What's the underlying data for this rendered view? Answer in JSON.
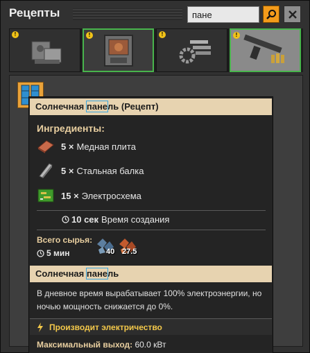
{
  "window": {
    "title": "Рецепты",
    "search": {
      "value": "пане",
      "icon": "search-icon",
      "close_icon": "close-icon"
    },
    "accent": "#f39b1b"
  },
  "tabs": [
    {
      "name": "logistics",
      "icon": "logistics-icon",
      "alert": "!"
    },
    {
      "name": "production",
      "icon": "production-icon",
      "alert": "!"
    },
    {
      "name": "intermediate-products",
      "icon": "intermediate-products-icon",
      "alert": "!"
    },
    {
      "name": "combat",
      "icon": "combat-icon",
      "alert": "!"
    }
  ],
  "recipe_slot": {
    "icon": "solar-panel-icon"
  },
  "tooltip": {
    "recipe_header": {
      "before": "Солнечная ",
      "highlight": "пане",
      "after": "ль (Рецепт)"
    },
    "ingredients_title": "Ингредиенты:",
    "ingredients": [
      {
        "amount": "5 ×",
        "name": "Медная плита",
        "icon": "copper-plate-icon"
      },
      {
        "amount": "5 ×",
        "name": "Стальная балка",
        "icon": "steel-beam-icon"
      },
      {
        "amount": "15 ×",
        "name": "Электросхема",
        "icon": "electronic-circuit-icon"
      }
    ],
    "craft_time": {
      "value": "10 сек",
      "label": "Время создания",
      "icon": "clock-icon"
    },
    "raw": {
      "title": "Всего сырья:",
      "time": "5 мин",
      "items": [
        {
          "icon": "iron-ore-icon",
          "amount": "40"
        },
        {
          "icon": "copper-ore-icon",
          "amount": "27.5"
        }
      ]
    },
    "entity_header": {
      "before": "Солнечная ",
      "highlight": "пане",
      "after": "ль"
    },
    "description": "В дневное время вырабатывает 100% электроэнергии, но ночью мощность снижается до 0%.",
    "produces": {
      "text": "Производит электричество",
      "icon": "lightning-icon"
    },
    "max_output": {
      "label": "Максимальный выход:",
      "value": "60.0 кВт"
    }
  }
}
